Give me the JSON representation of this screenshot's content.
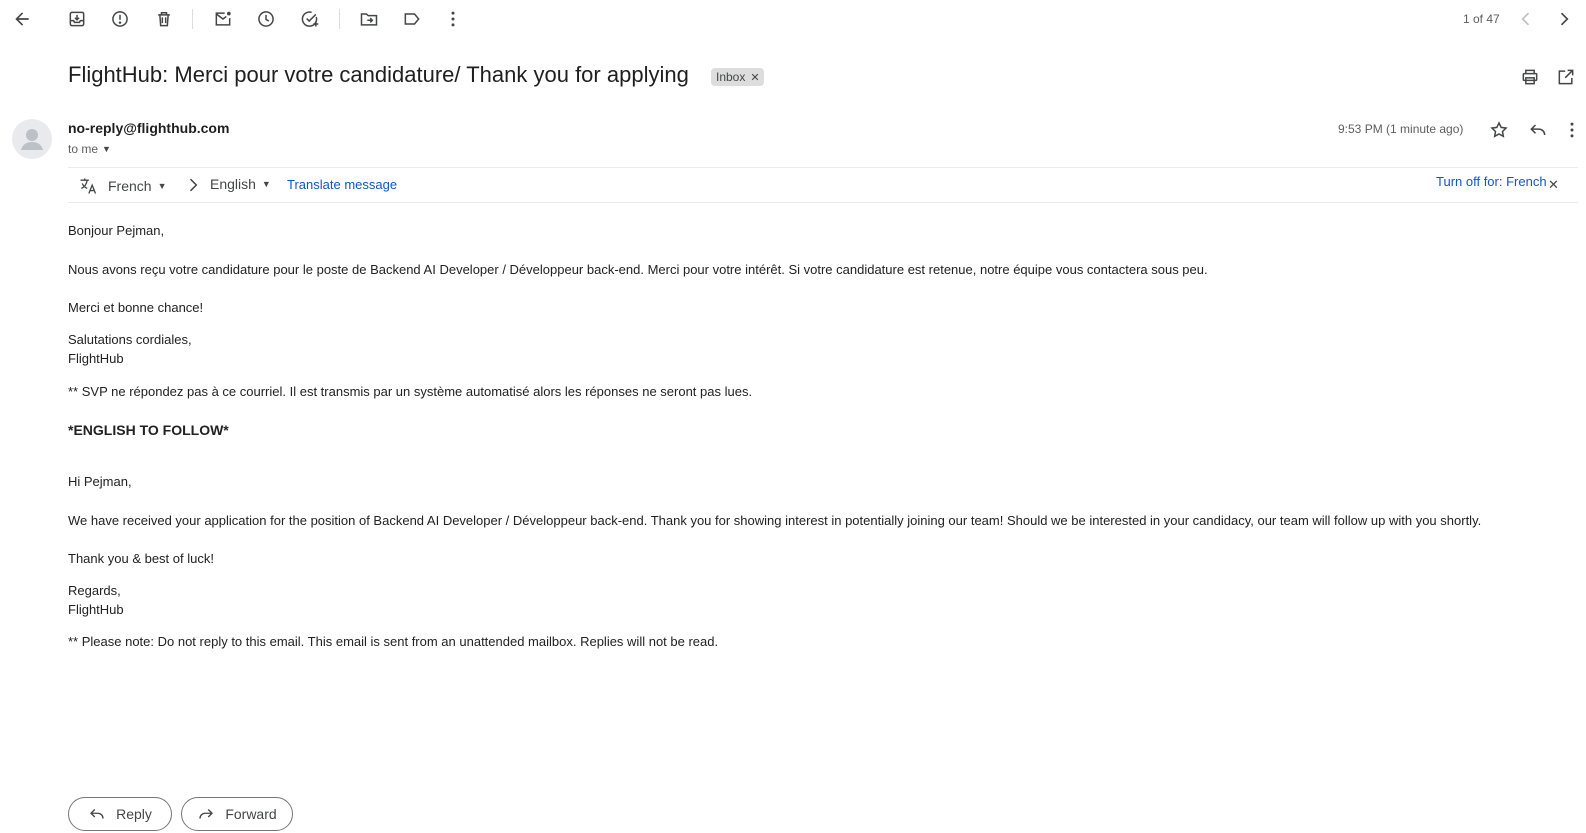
{
  "toolbar": {
    "icons": [
      "back-icon",
      "archive-icon",
      "report-spam-icon",
      "delete-icon",
      "mark-unread-icon",
      "snooze-icon",
      "add-task-icon",
      "move-to-icon",
      "label-icon",
      "more-icon"
    ],
    "pagination": "1 of 47"
  },
  "email": {
    "subject": "FlightHub: Merci pour votre candidature/ Thank you for applying",
    "label_chip": "Inbox",
    "sender": "no-reply@flighthub.com",
    "recipient": "to me",
    "time": "9:53 PM (1 minute ago)"
  },
  "translation": {
    "source_lang": "French",
    "target_lang": "English",
    "translate_link": "Translate message",
    "turn_off": "Turn off for: French"
  },
  "body": {
    "fr_greeting": "Bonjour Pejman,",
    "fr_p1": "Nous avons reçu votre candidature pour le poste de Backend AI Developer / Développeur back-end. Merci pour votre intérêt. Si votre candidature est retenue, notre équipe vous contactera sous peu.",
    "fr_p2": "Merci et bonne chance!",
    "fr_sign1": "Salutations cordiales,",
    "fr_sign2": "FlightHub",
    "fr_note": "** SVP ne répondez pas à ce courriel. Il est transmis par un système automatisé alors les réponses ne seront pas lues.",
    "divider": "*ENGLISH TO FOLLOW*",
    "en_greeting": "Hi Pejman,",
    "en_p1": "We have received your application for the position of Backend AI Developer / Développeur back-end. Thank you for showing interest in potentially joining our team! Should we be interested in your candidacy, our team will follow up with you shortly.",
    "en_p2": "Thank you & best of luck!",
    "en_sign1": "Regards,",
    "en_sign2": "FlightHub",
    "en_note": "** Please note: Do not reply to this email. This email is sent from an unattended mailbox. Replies will not be read."
  },
  "actions": {
    "reply_label": "Reply",
    "forward_label": "Forward"
  },
  "colors": {
    "link": "#0b57d0",
    "icon": "#444746",
    "chip_bg": "#dddddd"
  }
}
